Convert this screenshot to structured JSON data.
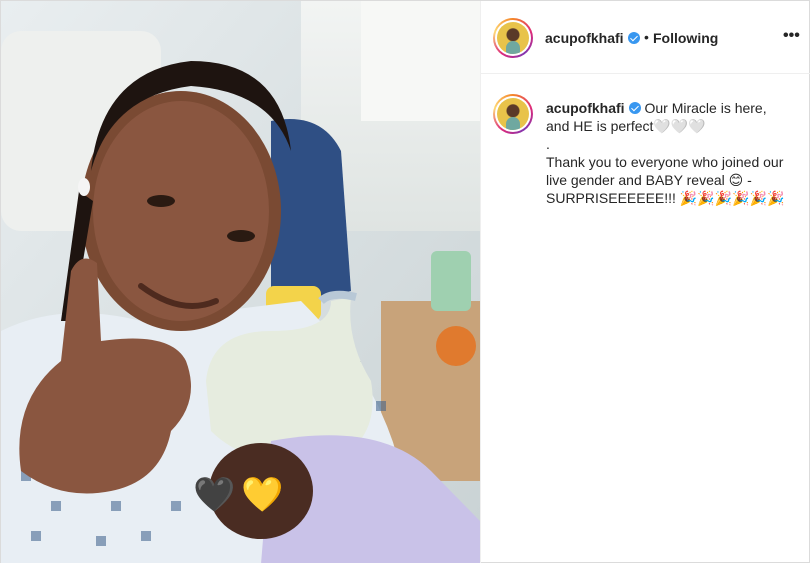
{
  "post": {
    "username": "acupofkhafi",
    "follow_status": "Following",
    "separator": "•",
    "more_label": "•••",
    "caption": {
      "username": "acupofkhafi",
      "line1": " Our Miracle is here,",
      "line2": "and HE is perfect🤍🤍🤍",
      "line3": ".",
      "line4": "Thank you to everyone who joined our",
      "line5": "live gender and BABY reveal 😊 -",
      "line6": "SURPRISEEEEEE!!! 🎉🎉🎉🎉🎉🎉"
    },
    "photo": {
      "emoji_hearts": [
        "🖤",
        "💛"
      ]
    }
  },
  "colors": {
    "verified": "#3897f0",
    "border": "#dbdbdb",
    "text": "#262626"
  }
}
